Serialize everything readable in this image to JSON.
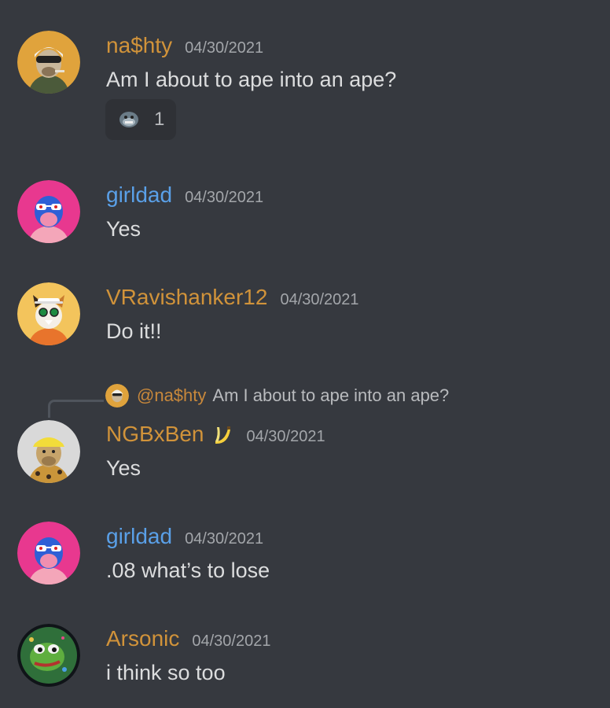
{
  "colors": {
    "background": "#36393f",
    "orange_role": "#d1933a",
    "blue_role": "#5aa0e8",
    "timestamp": "#a3a6aa",
    "text": "#dcddde"
  },
  "messages": [
    {
      "author": "na$hty",
      "timestamp": "04/30/2021",
      "text": "Am I about to ape into an ape?",
      "avatar_icon": "ape-helmet-avatar-icon",
      "reaction": {
        "emoji_icon": "ape-emoji-icon",
        "count": "1"
      }
    },
    {
      "author": "girldad",
      "timestamp": "04/30/2021",
      "text": "Yes",
      "avatar_icon": "blue-ape-avatar-icon"
    },
    {
      "author": "VRavishanker12",
      "timestamp": "04/30/2021",
      "text": "Do it!!",
      "avatar_icon": "cat-avatar-icon"
    },
    {
      "reply_to": {
        "mention": "@na$hty",
        "text": "Am I about to ape into an ape?"
      },
      "author": "NGBxBen",
      "author_emoji_icon": "banana-icon",
      "timestamp": "04/30/2021",
      "text": "Yes",
      "avatar_icon": "leopard-ape-avatar-icon"
    },
    {
      "author": "girldad",
      "timestamp": "04/30/2021",
      "text": ".08 what’s to lose",
      "avatar_icon": "blue-ape-avatar-icon"
    },
    {
      "author": "Arsonic",
      "timestamp": "04/30/2021",
      "text": "i think so too",
      "avatar_icon": "pepe-frog-avatar-icon"
    }
  ]
}
